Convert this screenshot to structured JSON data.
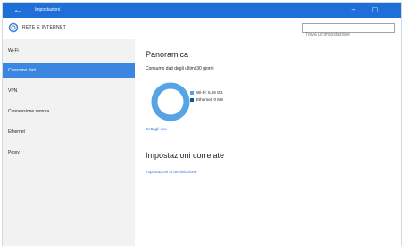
{
  "window": {
    "title": "Impostazioni",
    "back_icon": "arrow-left-icon",
    "minimize_label": "–",
    "maximize_label": "□"
  },
  "header": {
    "icon": "gear-icon",
    "title": "RETE E INTERNET",
    "search_placeholder": "Trova un'impostazione"
  },
  "sidebar": {
    "items": [
      {
        "label": "Wi-Fi",
        "active": false
      },
      {
        "label": "Consumo dati",
        "active": true
      },
      {
        "label": "VPN",
        "active": false
      },
      {
        "label": "Connessione remota",
        "active": false
      },
      {
        "label": "Ethernet",
        "active": false
      },
      {
        "label": "Proxy",
        "active": false
      }
    ]
  },
  "main": {
    "overview_title": "Panoramica",
    "overview_desc": "Consumo dati degli ultimi 30 giorni",
    "usage": [
      {
        "label": "Wi-Fi: 5,59 GB",
        "value_gb": 5.59,
        "color": "#56a3e6"
      },
      {
        "label": "Ethernet: 0 MB",
        "value_gb": 0,
        "color": "#1d4fa0"
      }
    ],
    "details_link": "Dettagli uso",
    "related_title": "Impostazioni correlate",
    "related_link": "Impostazioni di archiviazione"
  },
  "colors": {
    "titlebar": "#1f6fd8",
    "accent": "#3a86e0",
    "link": "#2c78d6",
    "ring": "#56a3e6"
  }
}
